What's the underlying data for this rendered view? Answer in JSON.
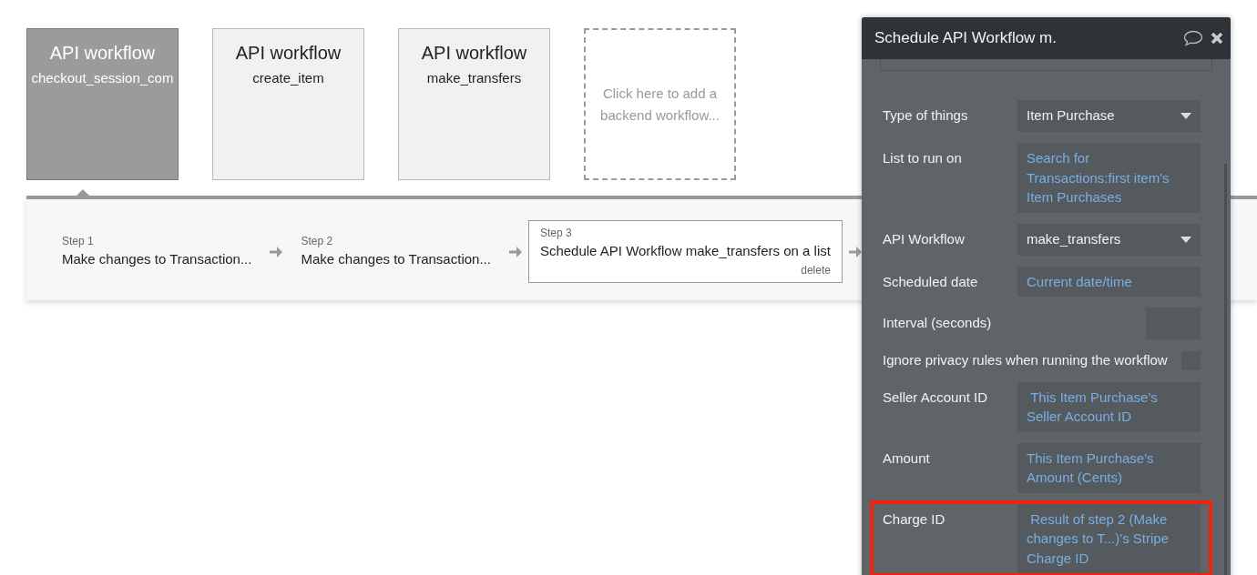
{
  "workflows": [
    {
      "kind": "workflow",
      "title": "API workflow",
      "name": "checkout_session_com",
      "selected": true
    },
    {
      "kind": "workflow",
      "title": "API workflow",
      "name": "create_item",
      "selected": false
    },
    {
      "kind": "workflow",
      "title": "API workflow",
      "name": "make_transfers",
      "selected": false
    },
    {
      "kind": "add",
      "text": "Click here to add a backend workflow..."
    }
  ],
  "steps": [
    {
      "label": "Step 1",
      "text": "Make changes to Transaction...",
      "selected": false
    },
    {
      "label": "Step 2",
      "text": "Make changes to Transaction...",
      "selected": false
    },
    {
      "label": "Step 3",
      "text": "Schedule API Workflow make_transfers on a list",
      "selected": true,
      "action": "delete"
    }
  ],
  "panel": {
    "title": "Schedule API Workflow m.",
    "fields": [
      {
        "kind": "dropdown",
        "label": "Type of things",
        "value": "Item Purchase",
        "highlighted": false
      },
      {
        "kind": "expression",
        "label": "List to run on",
        "value": "Search for Transactions:first item's Item Purchases",
        "highlighted": false
      },
      {
        "kind": "dropdown",
        "label": "API Workflow",
        "value": "make_transfers",
        "highlighted": false
      },
      {
        "kind": "expression",
        "label": "Scheduled date",
        "value": "Current date/time",
        "highlighted": false
      },
      {
        "kind": "number",
        "label": "Interval (seconds)",
        "highlighted": false
      },
      {
        "kind": "checkbox",
        "label": "Ignore privacy rules when running the workflow",
        "checked": false,
        "highlighted": false
      },
      {
        "kind": "expression",
        "label": "Seller Account ID",
        "value": " This Item Purchase's Seller Account ID",
        "highlighted": false
      },
      {
        "kind": "expression",
        "label": "Amount",
        "value": "This Item Purchase's Amount (Cents)",
        "highlighted": false
      },
      {
        "kind": "expression",
        "label": "Charge ID",
        "value": " Result of step 2 (Make changes to T...)'s Stripe Charge ID",
        "highlighted": true
      }
    ]
  }
}
